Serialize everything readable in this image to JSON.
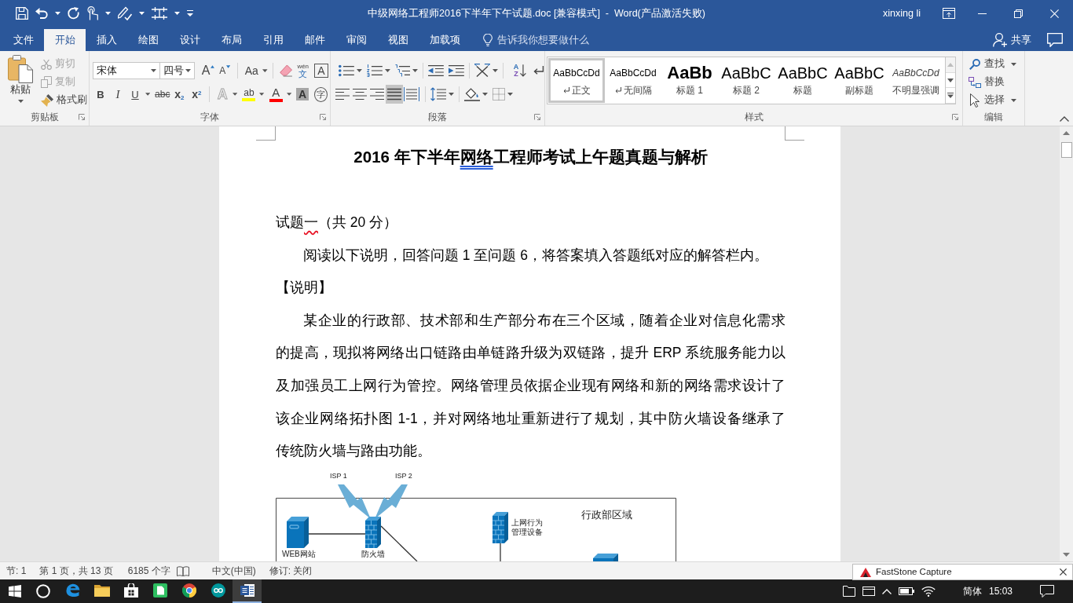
{
  "window": {
    "title": "中级网络工程师2016下半年下午试题.doc [兼容模式]  -  Word(产品激活失败)",
    "user": "xinxing li"
  },
  "tabs": [
    {
      "label": "文件",
      "selected": false
    },
    {
      "label": "开始",
      "selected": true
    },
    {
      "label": "插入",
      "selected": false
    },
    {
      "label": "绘图",
      "selected": false
    },
    {
      "label": "设计",
      "selected": false
    },
    {
      "label": "布局",
      "selected": false
    },
    {
      "label": "引用",
      "selected": false
    },
    {
      "label": "邮件",
      "selected": false
    },
    {
      "label": "审阅",
      "selected": false
    },
    {
      "label": "视图",
      "selected": false
    },
    {
      "label": "加载项",
      "selected": false
    }
  ],
  "tell_me": {
    "placeholder": "告诉我你想要做什么"
  },
  "share": {
    "label": "共享"
  },
  "ribbon": {
    "clipboard": {
      "label": "剪贴板",
      "paste": "粘贴",
      "items": [
        {
          "kind": "cut",
          "label": "剪切",
          "disabled": true
        },
        {
          "kind": "copy",
          "label": "复制",
          "disabled": true
        },
        {
          "kind": "format_painter",
          "label": "格式刷",
          "disabled": false
        }
      ]
    },
    "font": {
      "label": "字体",
      "font_name": "宋体",
      "font_size": "四号",
      "row1": [
        {
          "kind": "grow",
          "glyph": "A"
        },
        {
          "kind": "shrink",
          "glyph": "A"
        },
        {
          "kind": "change_case",
          "glyph": "Aa"
        },
        {
          "kind": "clear"
        },
        {
          "kind": "pinyin",
          "glyph": "wén",
          "glyph2": "文"
        },
        {
          "kind": "border",
          "glyph": "A"
        }
      ],
      "row2": [
        {
          "kind": "bold",
          "glyph": "B"
        },
        {
          "kind": "italic",
          "glyph": "I"
        },
        {
          "kind": "underline",
          "glyph": "U"
        },
        {
          "kind": "strike",
          "glyph": "abc"
        },
        {
          "kind": "subscript",
          "glyph": "x$_{2}$"
        },
        {
          "kind": "superscript",
          "glyph": "x$^{2}$"
        },
        {
          "kind": "effects",
          "glyph": "A"
        },
        {
          "kind": "highlight",
          "glyph": "ab",
          "color": "#ffff00"
        },
        {
          "kind": "font_color",
          "glyph": "A",
          "color": "#ff0000"
        },
        {
          "kind": "shading",
          "glyph": "A"
        },
        {
          "kind": "enclose",
          "glyph": "字"
        }
      ]
    },
    "paragraph": {
      "label": "段落",
      "sort_glyph": [
        "A",
        "Z"
      ],
      "align_buttons": [
        {
          "kind": "left",
          "selected": false
        },
        {
          "kind": "center",
          "selected": false
        },
        {
          "kind": "right",
          "selected": false
        },
        {
          "kind": "justify",
          "selected": true
        },
        {
          "kind": "distributed",
          "selected": false
        }
      ]
    },
    "styles": {
      "label": "样式",
      "gallery": [
        {
          "kind": "normal",
          "preview": "AaBbCcDd",
          "name": "正文",
          "selected": true
        },
        {
          "kind": "no_spacing",
          "preview": "AaBbCcDd",
          "name": "无间隔",
          "selected": false
        },
        {
          "kind": "heading1",
          "preview": "AaBb",
          "name": "标题 1",
          "selected": false
        },
        {
          "kind": "heading2",
          "preview": "AaBbC",
          "name": "标题 2",
          "selected": false
        },
        {
          "kind": "title",
          "preview": "AaBbC",
          "name": "标题",
          "selected": false
        },
        {
          "kind": "subtitle",
          "preview": "AaBbC",
          "name": "副标题",
          "selected": false
        },
        {
          "kind": "subtle_emphasis",
          "preview": "AaBbCcDd",
          "name": "不明显强调",
          "selected": false
        }
      ]
    },
    "editing": {
      "label": "编辑",
      "items": [
        {
          "kind": "find",
          "label": "查找"
        },
        {
          "kind": "replace",
          "label": "替换"
        },
        {
          "kind": "select",
          "label": "选择"
        }
      ]
    }
  },
  "document": {
    "paragraphs": [
      {
        "kind": "heading",
        "lines": [
          [
            {
              "kind": "plain",
              "text": "2016 年下半年"
            },
            {
              "kind": "grammar_error",
              "text": "网络"
            },
            {
              "kind": "plain",
              "text": "工程师考试上午题真题与解析"
            }
          ]
        ]
      },
      {
        "kind": "plain",
        "lines": [
          [
            {
              "kind": "plain",
              "text": "试题"
            },
            {
              "kind": "spelling_error",
              "text": "一"
            },
            {
              "kind": "plain",
              "text": "（共 20 分）"
            }
          ]
        ]
      },
      {
        "kind": "indented",
        "lines": [
          [
            {
              "kind": "plain",
              "text": "阅读以下说明，回答问题 1 至问题 6，将答案填入答题纸对应的解答栏内。"
            }
          ]
        ]
      },
      {
        "kind": "plain",
        "lines": [
          [
            {
              "kind": "plain",
              "text": "【说明】"
            }
          ]
        ]
      },
      {
        "kind": "indented",
        "lines": [
          [
            {
              "kind": "plain",
              "text": "某企业的行政部、技术部和生产部分布在三个区域，随着企业对信息化需求"
            }
          ],
          [
            {
              "kind": "plain",
              "text": "的提高，现拟将网络出口链路由单链路升级为双链路，提升 ERP 系统服务能力以"
            }
          ],
          [
            {
              "kind": "plain",
              "text": "及加强员工上网行为管控。网络管理员依据企业现有网络和新的网络需求设计了"
            }
          ],
          [
            {
              "kind": "plain",
              "text": "该企业网络拓扑图 1-1，并对网络地址重新进行了规划，其中防火墙设备继承了"
            }
          ],
          [
            {
              "kind": "plain",
              "text": "传统防火墙与路由功能。"
            }
          ]
        ]
      }
    ]
  },
  "figure": {
    "links": [
      {
        "label": "ISP 1"
      },
      {
        "label": "ISP 2"
      }
    ],
    "area_label": "行政部区域",
    "devices": [
      {
        "kind": "server",
        "label": "WEB网站"
      },
      {
        "kind": "firewall",
        "label": "防火墙"
      },
      {
        "kind": "firewall",
        "label": "上网行为管理设备"
      },
      {
        "kind": "server"
      }
    ]
  },
  "status_bar": {
    "section": "节: 1",
    "page": "第 1 页，共 13 页",
    "words": "6185 个字",
    "language": "中文(中国)",
    "track_changes": "修订: 关闭"
  },
  "popup": {
    "title": "FastStone Capture"
  },
  "taskbar": {
    "apps": [
      {
        "kind": "browser_e",
        "active": false
      },
      {
        "kind": "folder",
        "active": false
      },
      {
        "kind": "store",
        "active": false
      },
      {
        "kind": "notes",
        "active": false
      },
      {
        "kind": "browser_ring",
        "active": false
      },
      {
        "kind": "infinity",
        "active": false
      },
      {
        "kind": "document",
        "active": true
      }
    ],
    "ime": "简体",
    "clock": "15:03"
  }
}
